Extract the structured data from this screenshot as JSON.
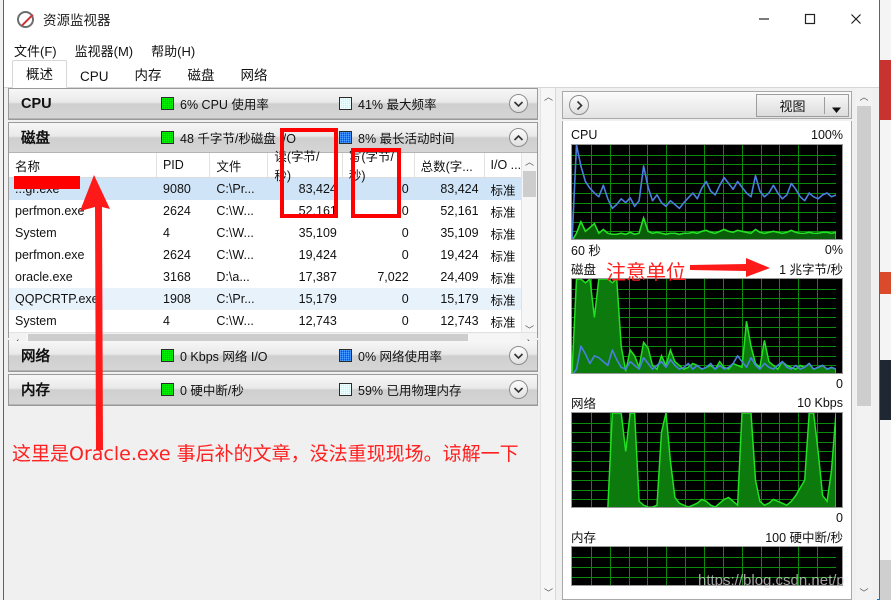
{
  "window": {
    "title": "资源监视器",
    "icon": "resource-monitor-icon",
    "minimize": "—",
    "maximize": "□",
    "close": "✕"
  },
  "menu": [
    {
      "label": "文件(F)"
    },
    {
      "label": "监视器(M)"
    },
    {
      "label": "帮助(H)"
    }
  ],
  "tabs": [
    {
      "label": "概述",
      "active": true
    },
    {
      "label": "CPU",
      "active": false
    },
    {
      "label": "内存",
      "active": false
    },
    {
      "label": "磁盘",
      "active": false
    },
    {
      "label": "网络",
      "active": false
    }
  ],
  "sections": {
    "cpu": {
      "title": "CPU",
      "stat1": "6% CPU 使用率",
      "stat2": "41% 最大频率",
      "expanded": false,
      "chevron": "chevron-down"
    },
    "disk": {
      "title": "磁盘",
      "stat1": "48 千字节/秒磁盘 I/O",
      "stat2": "8% 最长活动时间",
      "expanded": true,
      "chevron": "chevron-up"
    },
    "network": {
      "title": "网络",
      "stat1": "0 Kbps 网络 I/O",
      "stat2": "0% 网络使用率",
      "expanded": false,
      "chevron": "chevron-down"
    },
    "memory": {
      "title": "内存",
      "stat1": "0 硬中断/秒",
      "stat2": "59% 已用物理内存",
      "expanded": false,
      "chevron": "chevron-down"
    }
  },
  "disk_table": {
    "columns": [
      "名称",
      "PID",
      "文件",
      "读(字节/秒)",
      "写(字节/秒)",
      "总数(字...",
      "I/O ..."
    ],
    "sorted_column": "读(字节/秒)",
    "rows": [
      {
        "name": "...gr.exe",
        "pid": "9080",
        "file": "C:\\Pr...",
        "read": "83,424",
        "write": "0",
        "total": "83,424",
        "io": "标准",
        "selected": true,
        "redacted": true
      },
      {
        "name": "perfmon.exe",
        "pid": "2624",
        "file": "C:\\W...",
        "read": "52,161",
        "write": "0",
        "total": "52,161",
        "io": "标准",
        "selected": false,
        "redacted": false
      },
      {
        "name": "System",
        "pid": "4",
        "file": "C:\\W...",
        "read": "35,109",
        "write": "0",
        "total": "35,109",
        "io": "标准",
        "selected": false,
        "redacted": false
      },
      {
        "name": "perfmon.exe",
        "pid": "2624",
        "file": "C:\\W...",
        "read": "19,424",
        "write": "0",
        "total": "19,424",
        "io": "标准",
        "selected": false,
        "redacted": false
      },
      {
        "name": "oracle.exe",
        "pid": "3168",
        "file": "D:\\a...",
        "read": "17,387",
        "write": "7,022",
        "total": "24,409",
        "io": "标准",
        "selected": false,
        "redacted": false
      },
      {
        "name": "QQPCRTP.exe",
        "pid": "1908",
        "file": "C:\\Pr...",
        "read": "15,179",
        "write": "0",
        "total": "15,179",
        "io": "标准",
        "selected": true,
        "redacted": false
      },
      {
        "name": "System",
        "pid": "4",
        "file": "C:\\W...",
        "read": "12,743",
        "write": "0",
        "total": "12,743",
        "io": "标准",
        "selected": false,
        "redacted": false
      }
    ]
  },
  "right_panel": {
    "collapse_icon": "chevron-right",
    "view_button": "视图",
    "view_caret": "caret-down-icon"
  },
  "chart_data": [
    {
      "type": "line",
      "title": "CPU",
      "top_label": "100%",
      "bottom_left_label": "60 秒",
      "bottom_right_label": "0%",
      "ylim": [
        0,
        100
      ],
      "grid": true,
      "series": [
        {
          "name": "CPU 使用率",
          "color": "#4a7fe0",
          "values": [
            0,
            100,
            78,
            62,
            55,
            50,
            46,
            58,
            44,
            34,
            38,
            44,
            40,
            45,
            36,
            42,
            78,
            56,
            42,
            48,
            40,
            36,
            42,
            38,
            34,
            40,
            45,
            50,
            44,
            55,
            62,
            52,
            48,
            58,
            66,
            60,
            54,
            62,
            56,
            50,
            46,
            68,
            52,
            46,
            50,
            58,
            50,
            44,
            48,
            60,
            54,
            46,
            42,
            50,
            46,
            44,
            48,
            50,
            46,
            48
          ]
        },
        {
          "name": "最大频率",
          "color": "#22e022",
          "values": [
            0,
            8,
            20,
            10,
            14,
            18,
            8,
            12,
            8,
            7,
            7,
            8,
            7,
            9,
            7,
            8,
            24,
            10,
            8,
            9,
            8,
            7,
            8,
            8,
            7,
            8,
            8,
            9,
            8,
            10,
            11,
            9,
            8,
            10,
            12,
            10,
            9,
            11,
            10,
            9,
            8,
            12,
            9,
            8,
            9,
            10,
            9,
            8,
            9,
            11,
            9,
            8,
            8,
            9,
            8,
            8,
            9,
            9,
            8,
            9
          ]
        }
      ]
    },
    {
      "type": "area",
      "title": "磁盘",
      "top_label": "1 兆字节/秒",
      "bottom_right_label": "0",
      "ylim": [
        0,
        100
      ],
      "grid": true,
      "series": [
        {
          "name": "磁盘 I/O",
          "color": "#22e022",
          "values": [
            2,
            100,
            100,
            96,
            100,
            60,
            100,
            100,
            100,
            96,
            100,
            30,
            4,
            26,
            20,
            8,
            34,
            28,
            10,
            6,
            20,
            10,
            26,
            14,
            10,
            6,
            8,
            12,
            10,
            6,
            8,
            10,
            6,
            14,
            8,
            6,
            12,
            10,
            8,
            56,
            30,
            12,
            8,
            36,
            14,
            10,
            6,
            14,
            10,
            8,
            6,
            10,
            8,
            12,
            6,
            8,
            10,
            6,
            8,
            6
          ]
        },
        {
          "name": "最长活动时间",
          "color": "#4a7fe0",
          "values": [
            0,
            6,
            30,
            22,
            12,
            20,
            18,
            14,
            10,
            26,
            16,
            8,
            6,
            14,
            10,
            6,
            18,
            12,
            6,
            10,
            14,
            8,
            16,
            10,
            6,
            8,
            12,
            6,
            10,
            6,
            8,
            12,
            6,
            10,
            6,
            8,
            12,
            20,
            14,
            8,
            18,
            10,
            6,
            12,
            8,
            6,
            10,
            14,
            8,
            6,
            10,
            6,
            8,
            12,
            6,
            8,
            10,
            6,
            8,
            6
          ]
        }
      ]
    },
    {
      "type": "area",
      "title": "网络",
      "top_label": "10 Kbps",
      "bottom_right_label": "0",
      "ylim": [
        0,
        100
      ],
      "grid": true,
      "series": [
        {
          "name": "网络 I/O",
          "color": "#22e022",
          "values": [
            0,
            0,
            0,
            0,
            0,
            0,
            0,
            0,
            0,
            100,
            100,
            100,
            60,
            100,
            100,
            8,
            4,
            2,
            2,
            4,
            80,
            100,
            50,
            12,
            6,
            4,
            2,
            4,
            6,
            10,
            8,
            4,
            2,
            6,
            10,
            12,
            8,
            4,
            100,
            100,
            100,
            30,
            8,
            4,
            6,
            10,
            8,
            6,
            4,
            8,
            14,
            22,
            30,
            100,
            100,
            60,
            14,
            8,
            40,
            100
          ]
        }
      ]
    },
    {
      "type": "area",
      "title": "内存",
      "top_label": "100 硬中断/秒",
      "ylim": [
        0,
        100
      ],
      "grid": true,
      "series": [
        {
          "name": "硬中断/秒",
          "color": "#22e022",
          "values": [
            0,
            0,
            0,
            0,
            0,
            0,
            0,
            0,
            0,
            0,
            0,
            0,
            0,
            0,
            0,
            0,
            0,
            0,
            0,
            0
          ]
        }
      ]
    }
  ],
  "annotations": {
    "note_arrow_left": "red-arrow-up",
    "note_text_bottom": "这里是Oracle.exe 事后补的文章，没法重现现场。谅解一下",
    "note_unit": "注意单位",
    "note_unit_arrow": "red-arrow-right",
    "box_read": "red-box-read-column",
    "box_write": "red-box-write-column",
    "redaction_bar": "red-redaction-bar"
  },
  "watermark": "https://blog.csdn.net/p"
}
